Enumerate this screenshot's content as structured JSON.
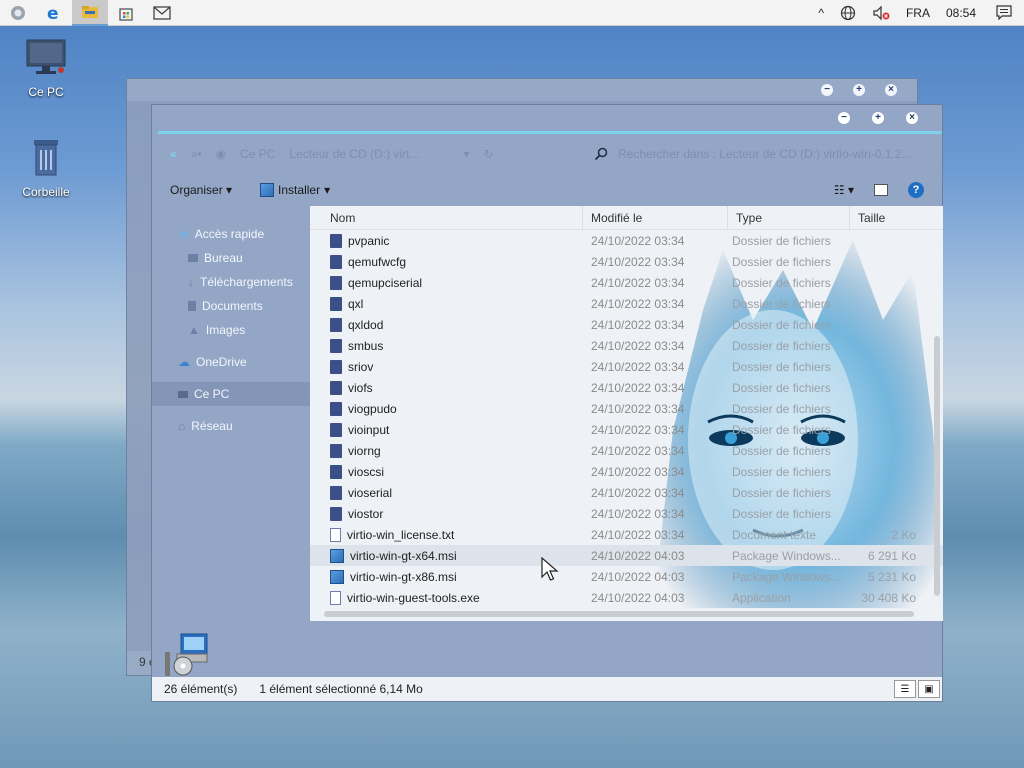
{
  "taskbar": {
    "apps": [
      {
        "name": "start",
        "icon": "start-icon"
      },
      {
        "name": "edge",
        "icon": "edge-icon"
      },
      {
        "name": "explorer",
        "icon": "folder-icon"
      },
      {
        "name": "store",
        "icon": "store-icon"
      },
      {
        "name": "mail",
        "icon": "mail-icon"
      }
    ],
    "tray": {
      "chevron": "^",
      "lang": "FRA",
      "time": "08:54"
    }
  },
  "desktop": {
    "icons": [
      {
        "label": "Ce PC",
        "icon": "computer-icon"
      },
      {
        "label": "Corbeille",
        "icon": "recycle-bin-icon"
      }
    ]
  },
  "back_window": {
    "status_count": "9 é"
  },
  "explorer": {
    "address": {
      "crumbs": [
        "Ce PC",
        "Lecteur de CD (D:) virt..."
      ],
      "search_placeholder": "Rechercher dans : Lecteur de CD (D:) virtio-win-0.1.2..."
    },
    "toolbar": {
      "organize": "Organiser",
      "install": "Installer"
    },
    "nav": [
      {
        "label": "Accès rapide",
        "icon": "star-icon",
        "sub": false
      },
      {
        "label": "Bureau",
        "icon": "desktop-icon",
        "sub": true
      },
      {
        "label": "Téléchargements",
        "icon": "download-icon",
        "sub": true
      },
      {
        "label": "Documents",
        "icon": "document-icon",
        "sub": true
      },
      {
        "label": "Images",
        "icon": "image-icon",
        "sub": true
      },
      {
        "label": "OneDrive",
        "icon": "cloud-icon",
        "sub": false
      },
      {
        "label": "Ce PC",
        "icon": "computer-icon",
        "sub": false,
        "selected": true
      },
      {
        "label": "Réseau",
        "icon": "network-icon",
        "sub": false
      }
    ],
    "columns": {
      "name": "Nom",
      "modified": "Modifié le",
      "type": "Type",
      "size": "Taille"
    },
    "files": [
      {
        "name": "pvpanic",
        "date": "24/10/2022 03:34",
        "type": "Dossier de fichiers",
        "size": "",
        "kind": "folder"
      },
      {
        "name": "qemufwcfg",
        "date": "24/10/2022 03:34",
        "type": "Dossier de fichiers",
        "size": "",
        "kind": "folder"
      },
      {
        "name": "qemupciserial",
        "date": "24/10/2022 03:34",
        "type": "Dossier de fichiers",
        "size": "",
        "kind": "folder"
      },
      {
        "name": "qxl",
        "date": "24/10/2022 03:34",
        "type": "Dossier de fichiers",
        "size": "",
        "kind": "folder"
      },
      {
        "name": "qxldod",
        "date": "24/10/2022 03:34",
        "type": "Dossier de fichiers",
        "size": "",
        "kind": "folder"
      },
      {
        "name": "smbus",
        "date": "24/10/2022 03:34",
        "type": "Dossier de fichiers",
        "size": "",
        "kind": "folder"
      },
      {
        "name": "sriov",
        "date": "24/10/2022 03:34",
        "type": "Dossier de fichiers",
        "size": "",
        "kind": "folder"
      },
      {
        "name": "viofs",
        "date": "24/10/2022 03:34",
        "type": "Dossier de fichiers",
        "size": "",
        "kind": "folder"
      },
      {
        "name": "viogpudo",
        "date": "24/10/2022 03:34",
        "type": "Dossier de fichiers",
        "size": "",
        "kind": "folder"
      },
      {
        "name": "vioinput",
        "date": "24/10/2022 03:34",
        "type": "Dossier de fichiers",
        "size": "",
        "kind": "folder"
      },
      {
        "name": "viorng",
        "date": "24/10/2022 03:34",
        "type": "Dossier de fichiers",
        "size": "",
        "kind": "folder"
      },
      {
        "name": "vioscsi",
        "date": "24/10/2022 03:34",
        "type": "Dossier de fichiers",
        "size": "",
        "kind": "folder"
      },
      {
        "name": "vioserial",
        "date": "24/10/2022 03:34",
        "type": "Dossier de fichiers",
        "size": "",
        "kind": "folder"
      },
      {
        "name": "viostor",
        "date": "24/10/2022 03:34",
        "type": "Dossier de fichiers",
        "size": "",
        "kind": "folder"
      },
      {
        "name": "virtio-win_license.txt",
        "date": "24/10/2022 03:34",
        "type": "Document texte",
        "size": "2 Ko",
        "kind": "file"
      },
      {
        "name": "virtio-win-gt-x64.msi",
        "date": "24/10/2022 04:03",
        "type": "Package Windows...",
        "size": "6 291 Ko",
        "kind": "msi",
        "selected": true
      },
      {
        "name": "virtio-win-gt-x86.msi",
        "date": "24/10/2022 04:03",
        "type": "Package Windows...",
        "size": "5 231 Ko",
        "kind": "msi"
      },
      {
        "name": "virtio-win-guest-tools.exe",
        "date": "24/10/2022 04:03",
        "type": "Application",
        "size": "30 408 Ko",
        "kind": "file"
      }
    ],
    "status": {
      "count": "26 élément(s)",
      "selection": "1 élément sélectionné  6,14 Mo"
    }
  },
  "colors": {
    "accent": "#7fd2ec",
    "folder": "#3c4f86",
    "window": "#93a6c6"
  }
}
